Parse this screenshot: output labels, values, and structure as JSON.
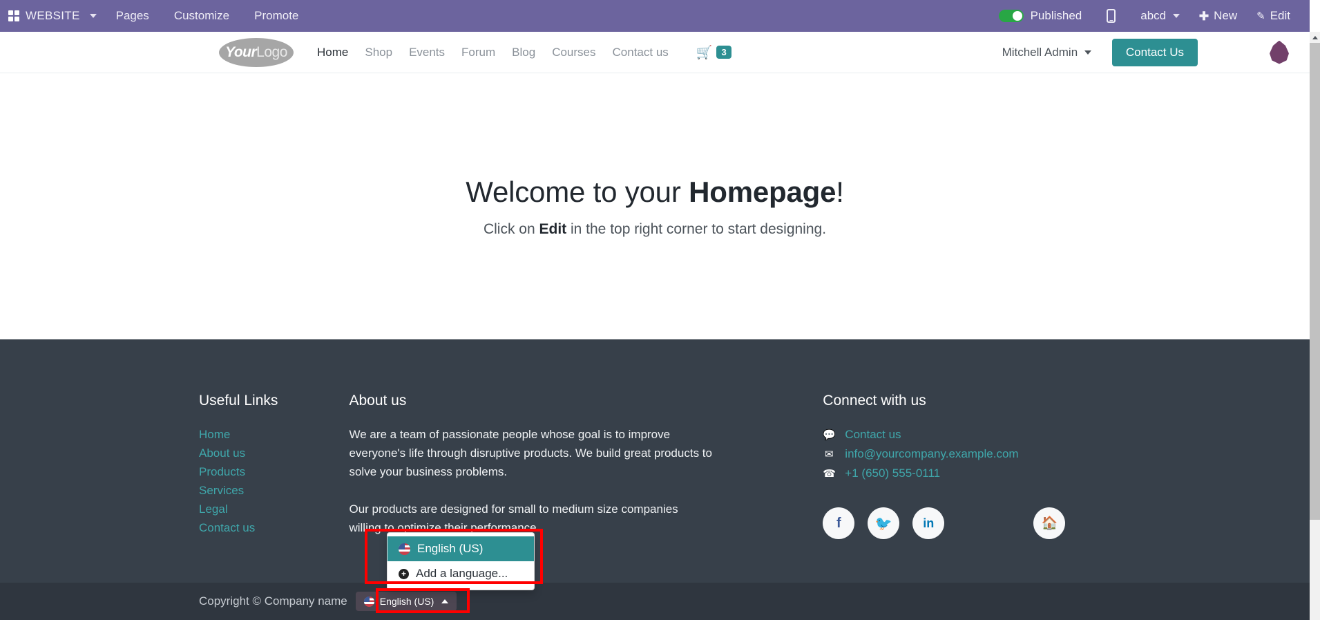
{
  "backend_bar": {
    "apps_icon": "grid-apps-icon",
    "app_name": "WEBSITE",
    "menus": [
      {
        "label": "Pages"
      },
      {
        "label": "Customize"
      },
      {
        "label": "Promote"
      }
    ],
    "publish_toggle": {
      "label": "Published",
      "state": "on",
      "color": "#28a745"
    },
    "mobile_preview_icon": "mobile-icon",
    "user": "abcd",
    "new_label": "New",
    "new_icon": "plus-icon",
    "edit_label": "Edit",
    "edit_icon": "pencil-icon",
    "bar_color": "#6c649e"
  },
  "site_header": {
    "logo": {
      "bold_part": "Your",
      "light_part": "Logo"
    },
    "nav": [
      {
        "label": "Home",
        "active": true
      },
      {
        "label": "Shop",
        "active": false
      },
      {
        "label": "Events",
        "active": false
      },
      {
        "label": "Forum",
        "active": false
      },
      {
        "label": "Blog",
        "active": false
      },
      {
        "label": "Courses",
        "active": false
      },
      {
        "label": "Contact us",
        "active": false
      }
    ],
    "cart": {
      "icon": "shopping-cart-icon",
      "count": "3"
    },
    "user_menu": "Mitchell Admin",
    "cta_button": "Contact Us",
    "avatar_icon": "droplet-avatar-icon",
    "accent_color": "#2d8f92"
  },
  "hero": {
    "title_prefix": "Welcome to your ",
    "title_bold": "Homepage",
    "title_suffix": "!",
    "subtitle_prefix": "Click on ",
    "subtitle_bold": "Edit",
    "subtitle_suffix": " in the top right corner to start designing."
  },
  "footer": {
    "background": "#37404a",
    "useful_links": {
      "title": "Useful Links",
      "items": [
        {
          "label": "Home"
        },
        {
          "label": "About us"
        },
        {
          "label": "Products"
        },
        {
          "label": "Services"
        },
        {
          "label": "Legal"
        },
        {
          "label": "Contact us"
        }
      ]
    },
    "about": {
      "title": "About us",
      "paragraph1": "We are a team of passionate people whose goal is to improve everyone's life through disruptive products. We build great products to solve your business problems.",
      "paragraph2": "Our products are designed for small to medium size companies willing to optimize their performance."
    },
    "connect": {
      "title": "Connect with us",
      "rows": [
        {
          "icon": "comment-icon",
          "label": "Contact us"
        },
        {
          "icon": "envelope-icon",
          "label": "info@yourcompany.example.com"
        },
        {
          "icon": "phone-icon",
          "label": "+1 (650) 555-0111"
        }
      ],
      "socials": [
        {
          "icon": "facebook-icon",
          "glyph": "f"
        },
        {
          "icon": "twitter-icon",
          "glyph": "ᵗ"
        },
        {
          "icon": "linkedin-icon",
          "glyph": "in"
        }
      ],
      "home_social": {
        "icon": "home-icon",
        "glyph": "⌂"
      }
    }
  },
  "copyright_bar": {
    "background": "#2f363f",
    "text": "Copyright © Company name",
    "language_button": {
      "flag_icon": "us-flag-icon",
      "label": "English (US)",
      "caret_icon": "caret-up-icon",
      "expanded": true
    }
  },
  "language_dropdown": {
    "open": true,
    "items": [
      {
        "icon": "us-flag-icon",
        "label": "English (US)",
        "selected": true
      },
      {
        "icon": "plus-circle-icon",
        "label": "Add a language...",
        "selected": false
      }
    ],
    "selected_background": "#2d8f92"
  },
  "annotations": {
    "highlight_color": "#ff0000",
    "boxes": [
      {
        "name": "language-dropdown-menu"
      },
      {
        "name": "language-selector-button"
      }
    ]
  },
  "scrollbar": {
    "up_arrow_icon": "caret-up-icon",
    "orientation": "vertical"
  }
}
